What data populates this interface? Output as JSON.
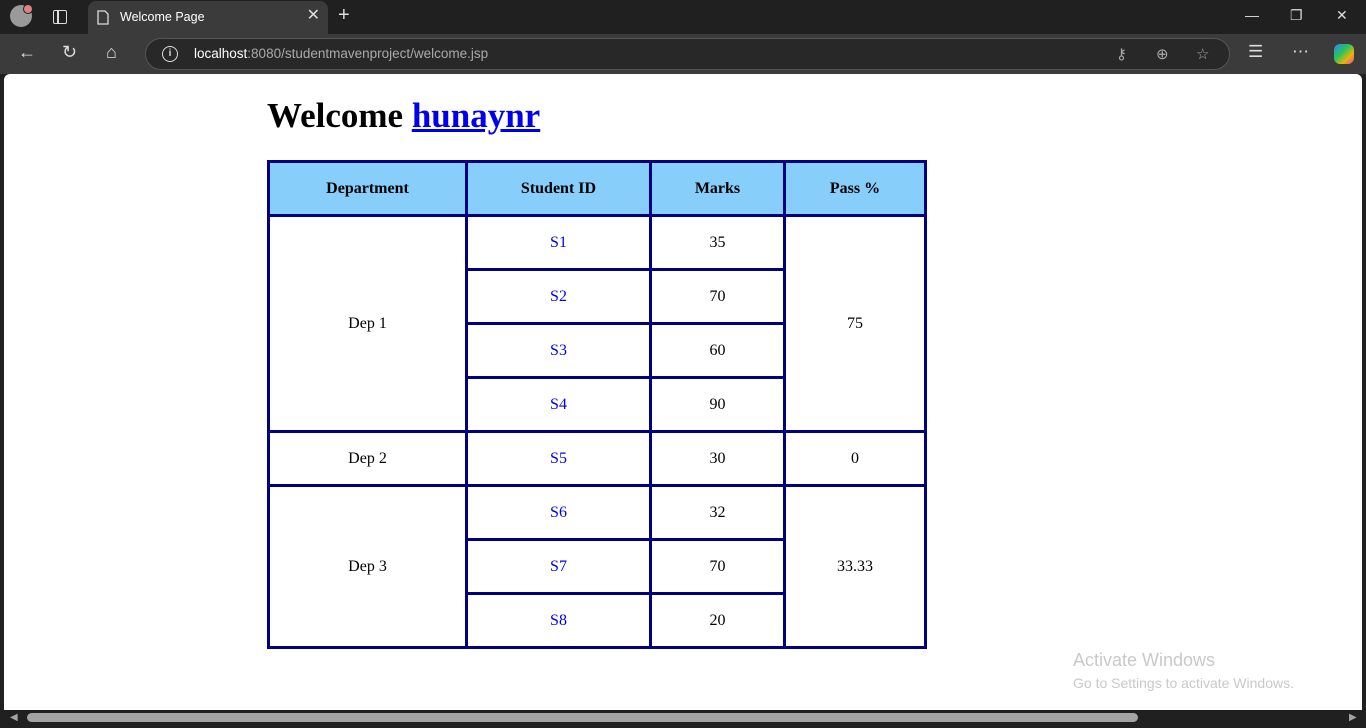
{
  "browser": {
    "tab_title": "Welcome Page",
    "url_host": "localhost",
    "url_path": ":8080/studentmavenproject/welcome.jsp"
  },
  "page": {
    "heading_prefix": "Welcome",
    "username": "hunaynr"
  },
  "table": {
    "headers": [
      "Department",
      "Student ID",
      "Marks",
      "Pass %"
    ],
    "groups": [
      {
        "department": "Dep 1",
        "pass_percent": "75",
        "students": [
          {
            "id": "S1",
            "marks": "35"
          },
          {
            "id": "S2",
            "marks": "70"
          },
          {
            "id": "S3",
            "marks": "60"
          },
          {
            "id": "S4",
            "marks": "90"
          }
        ]
      },
      {
        "department": "Dep 2",
        "pass_percent": "0",
        "students": [
          {
            "id": "S5",
            "marks": "30"
          }
        ]
      },
      {
        "department": "Dep 3",
        "pass_percent": "33.33",
        "students": [
          {
            "id": "S6",
            "marks": "32"
          },
          {
            "id": "S7",
            "marks": "70"
          },
          {
            "id": "S8",
            "marks": "20"
          }
        ]
      }
    ]
  },
  "watermark": {
    "line1": "Activate Windows",
    "line2": "Go to Settings to activate Windows."
  },
  "colors": {
    "header_bg": "#87cefa",
    "border": "#000080",
    "link": "#0000ee"
  }
}
